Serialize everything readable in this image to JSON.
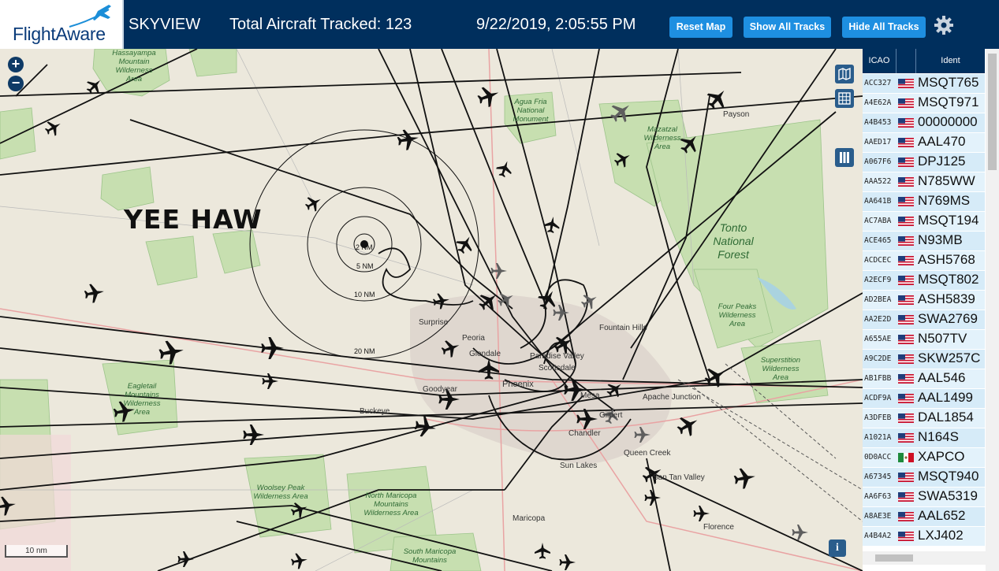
{
  "header": {
    "logo_text": "FlightAware",
    "app_title": "SKYVIEW",
    "tracked_label": "Total Aircraft Tracked: 123",
    "timestamp": "9/22/2019, 2:05:55 PM",
    "buttons": {
      "reset": "Reset Map",
      "show_all": "Show All Tracks",
      "hide_all": "Hide All Tracks"
    },
    "settings_icon": "gear-icon"
  },
  "map": {
    "overlay_title": "YEE HAW",
    "zoom_in": "+",
    "zoom_out": "−",
    "scale": "10 nm",
    "info": "i",
    "range_rings": [
      "2 NM",
      "5 NM",
      "10 NM",
      "20 NM"
    ],
    "places": {
      "surprise": "Surprise",
      "peoria": "Peoria",
      "glendale": "Glendale",
      "paradise_valley": "Paradise Valley",
      "scottsdale": "Scottsdale",
      "phoenix": "Phoenix",
      "goodyear": "Goodyear",
      "buckeye": "Buckeye",
      "mesa": "Mesa",
      "gilbert": "Gilbert",
      "chandler": "Chandler",
      "apache_junction": "Apache Junction",
      "queen_creek": "Queen Creek",
      "sun_lakes": "Sun Lakes",
      "san_tan_valley": "San Tan Valley",
      "florence": "Florence",
      "maricopa": "Maricopa",
      "fountain_hills": "Fountain Hills",
      "payson": "Payson"
    },
    "areas": {
      "hassayampa": "Hassayampa Mountain Wilderness Area",
      "agua_fria": "Agua Fria National Monument",
      "mazatzal": "Mazatzal Wilderness Area",
      "tonto": "Tonto National Forest",
      "four_peaks": "Four Peaks Wilderness Area",
      "superstition": "Superstition Wilderness Area",
      "eagletail": "Eagletail Mountains Wilderness Area",
      "woolsey": "Woolsey Peak Wilderness Area",
      "north_maricopa": "North Maricopa Mountains Wilderness Area",
      "south_maricopa": "South Maricopa Mountains"
    },
    "icons": [
      "plus-icon",
      "minus-icon",
      "map-layer-icon",
      "grid-icon",
      "columns-icon",
      "info-icon",
      "aircraft-icon"
    ]
  },
  "table": {
    "columns": [
      "ICAO",
      "",
      "Ident"
    ],
    "rows": [
      {
        "icao": "ACC327",
        "flag": "us",
        "ident": "MSQT765"
      },
      {
        "icao": "A4E62A",
        "flag": "us",
        "ident": "MSQT971"
      },
      {
        "icao": "A4B453",
        "flag": "us",
        "ident": "00000000"
      },
      {
        "icao": "AAED17",
        "flag": "us",
        "ident": "AAL470"
      },
      {
        "icao": "A067F6",
        "flag": "us",
        "ident": "DPJ125"
      },
      {
        "icao": "AAA522",
        "flag": "us",
        "ident": "N785WW"
      },
      {
        "icao": "AA641B",
        "flag": "us",
        "ident": "N769MS"
      },
      {
        "icao": "AC7ABA",
        "flag": "us",
        "ident": "MSQT194"
      },
      {
        "icao": "ACE465",
        "flag": "us",
        "ident": "N93MB"
      },
      {
        "icao": "ACDCEC",
        "flag": "us",
        "ident": "ASH5768"
      },
      {
        "icao": "A2ECF9",
        "flag": "us",
        "ident": "MSQT802"
      },
      {
        "icao": "AD2BEA",
        "flag": "us",
        "ident": "ASH5839"
      },
      {
        "icao": "AA2E2D",
        "flag": "us",
        "ident": "SWA2769"
      },
      {
        "icao": "A655AE",
        "flag": "us",
        "ident": "N507TV"
      },
      {
        "icao": "A9C2DE",
        "flag": "us",
        "ident": "SKW257C"
      },
      {
        "icao": "AB1FBB",
        "flag": "us",
        "ident": "AAL546"
      },
      {
        "icao": "ACDF9A",
        "flag": "us",
        "ident": "AAL1499"
      },
      {
        "icao": "A3DFEB",
        "flag": "us",
        "ident": "DAL1854"
      },
      {
        "icao": "A1021A",
        "flag": "us",
        "ident": "N164S"
      },
      {
        "icao": "0D0ACC",
        "flag": "mx",
        "ident": "XAPCO"
      },
      {
        "icao": "A67345",
        "flag": "us",
        "ident": "MSQT940"
      },
      {
        "icao": "AA6F63",
        "flag": "us",
        "ident": "SWA5319"
      },
      {
        "icao": "A8AE3E",
        "flag": "us",
        "ident": "AAL652"
      },
      {
        "icao": "A4B4A2",
        "flag": "us",
        "ident": "LXJ402"
      }
    ]
  },
  "colors": {
    "header_bg": "#002f5d",
    "button_bg": "#1e8fe1",
    "row_bg": "#d6ebf8",
    "map_land": "#ece8dc",
    "map_green": "#c7dfb0"
  }
}
